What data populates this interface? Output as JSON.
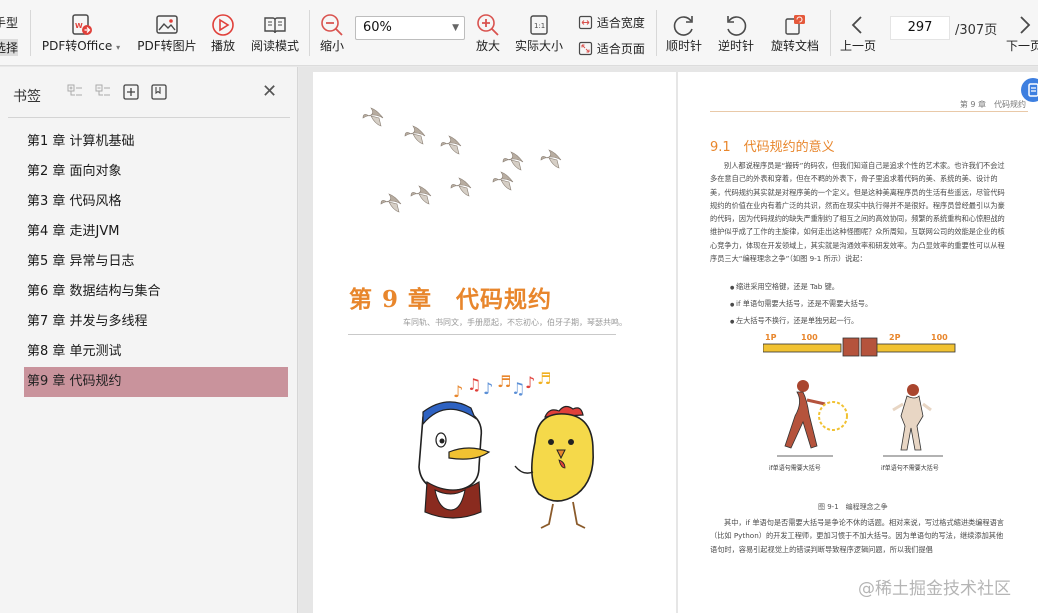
{
  "toolbar": {
    "left_cut_top": "手型",
    "left_cut_bottom": "选择",
    "pdf_to_office": "PDF转Office",
    "pdf_to_image": "PDF转图片",
    "play": "播放",
    "read_mode": "阅读模式",
    "zoom_out": "缩小",
    "zoom_value": "60%",
    "zoom_in": "放大",
    "actual_size": "实际大小",
    "fit_width": "适合宽度",
    "fit_page": "适合页面",
    "rotate_cw": "顺时针",
    "rotate_ccw": "逆时针",
    "rotate_doc": "旋转文档",
    "prev_page": "上一页",
    "next_page": "下一页",
    "current_page": "297",
    "total_pages": "/307页"
  },
  "sidebar": {
    "title": "书签",
    "items": [
      {
        "label": "第1 章 计算机基础"
      },
      {
        "label": "第2 章 面向对象"
      },
      {
        "label": "第3 章 代码风格"
      },
      {
        "label": "第4 章 走进JVM"
      },
      {
        "label": "第5 章 异常与日志"
      },
      {
        "label": "第6 章 数据结构与集合"
      },
      {
        "label": "第7 章 并发与多线程"
      },
      {
        "label": "第8 章 单元测试"
      },
      {
        "label": "第9 章 代码规约"
      }
    ],
    "active_index": 8
  },
  "left_page": {
    "chapter_title": "第 9 章　代码规约",
    "motto": "车同轨、书同文，手册愿起，不忘初心，伯牙子期，琴瑟共鸣。"
  },
  "right_page": {
    "running_head": "第 9 章　代码规约",
    "section_title": "9.1　代码规约的意义",
    "paragraph1": "别人都说程序员是“搬砖”的码农，但我们知道自己是追求个性的艺术家。也许我们不会过多在意自己的外表和穿着，但在不羁的外表下，骨子里追求着代码的美、系统的美、设计的美，代码规约其实就是对程序美的一个定义。但是这种美离程序员的生活有些遥远，尽管代码规约的价值在业内有着广泛的共识，然而在现实中执行得并不是很好。程序员曾经最引以为豪的代码，因为代码规约的缺失严重制约了相互之间的高效协同，频繁的系统重构和心惊胆战的维护似乎成了工作的主旋律，如何走出这种怪圈呢？众所周知，互联网公司的效能是企业的核心竞争力，体现在开发领域上，其实就是沟通效率和研发效率。为凸显效率的重要性可以从程序员三大“编程理念之争”（如图 9-1 所示）说起：",
    "bullets": [
      "缩进采用空格键，还是 Tab 键。",
      "if 单语句需要大括号，还是不需要大括号。",
      "左大括号不换行，还是单独另起一行。"
    ],
    "hud": {
      "p1": "1P",
      "score1": "100",
      "p2": "2P",
      "score2": "100"
    },
    "fighter_caption_left": "if单语句需要大括号",
    "fighter_caption_right": "if单语句不需要大括号",
    "figure_caption": "图 9-1　编程理念之争",
    "paragraph2": "其中，if 单语句是否需要大括号是争论不休的话题。相对来说，写过格式缩进类编程语言（比如 Python）的开发工程师，更加习惯于不加大括号。因为单语句的写法，继续添加其他语句时，容易引起视觉上的错误判断导致程序逻辑问题，所以我们提倡"
  },
  "watermark": "@稀土掘金技术社区",
  "colors": {
    "accent_orange": "#e8862c",
    "active_bookmark": "#c9939c",
    "toolbar_icon": "#4a4a4a",
    "rotate_doc_badge": "#e5593b",
    "zoom_red": "#d9534f",
    "play_red": "#e0403a"
  }
}
